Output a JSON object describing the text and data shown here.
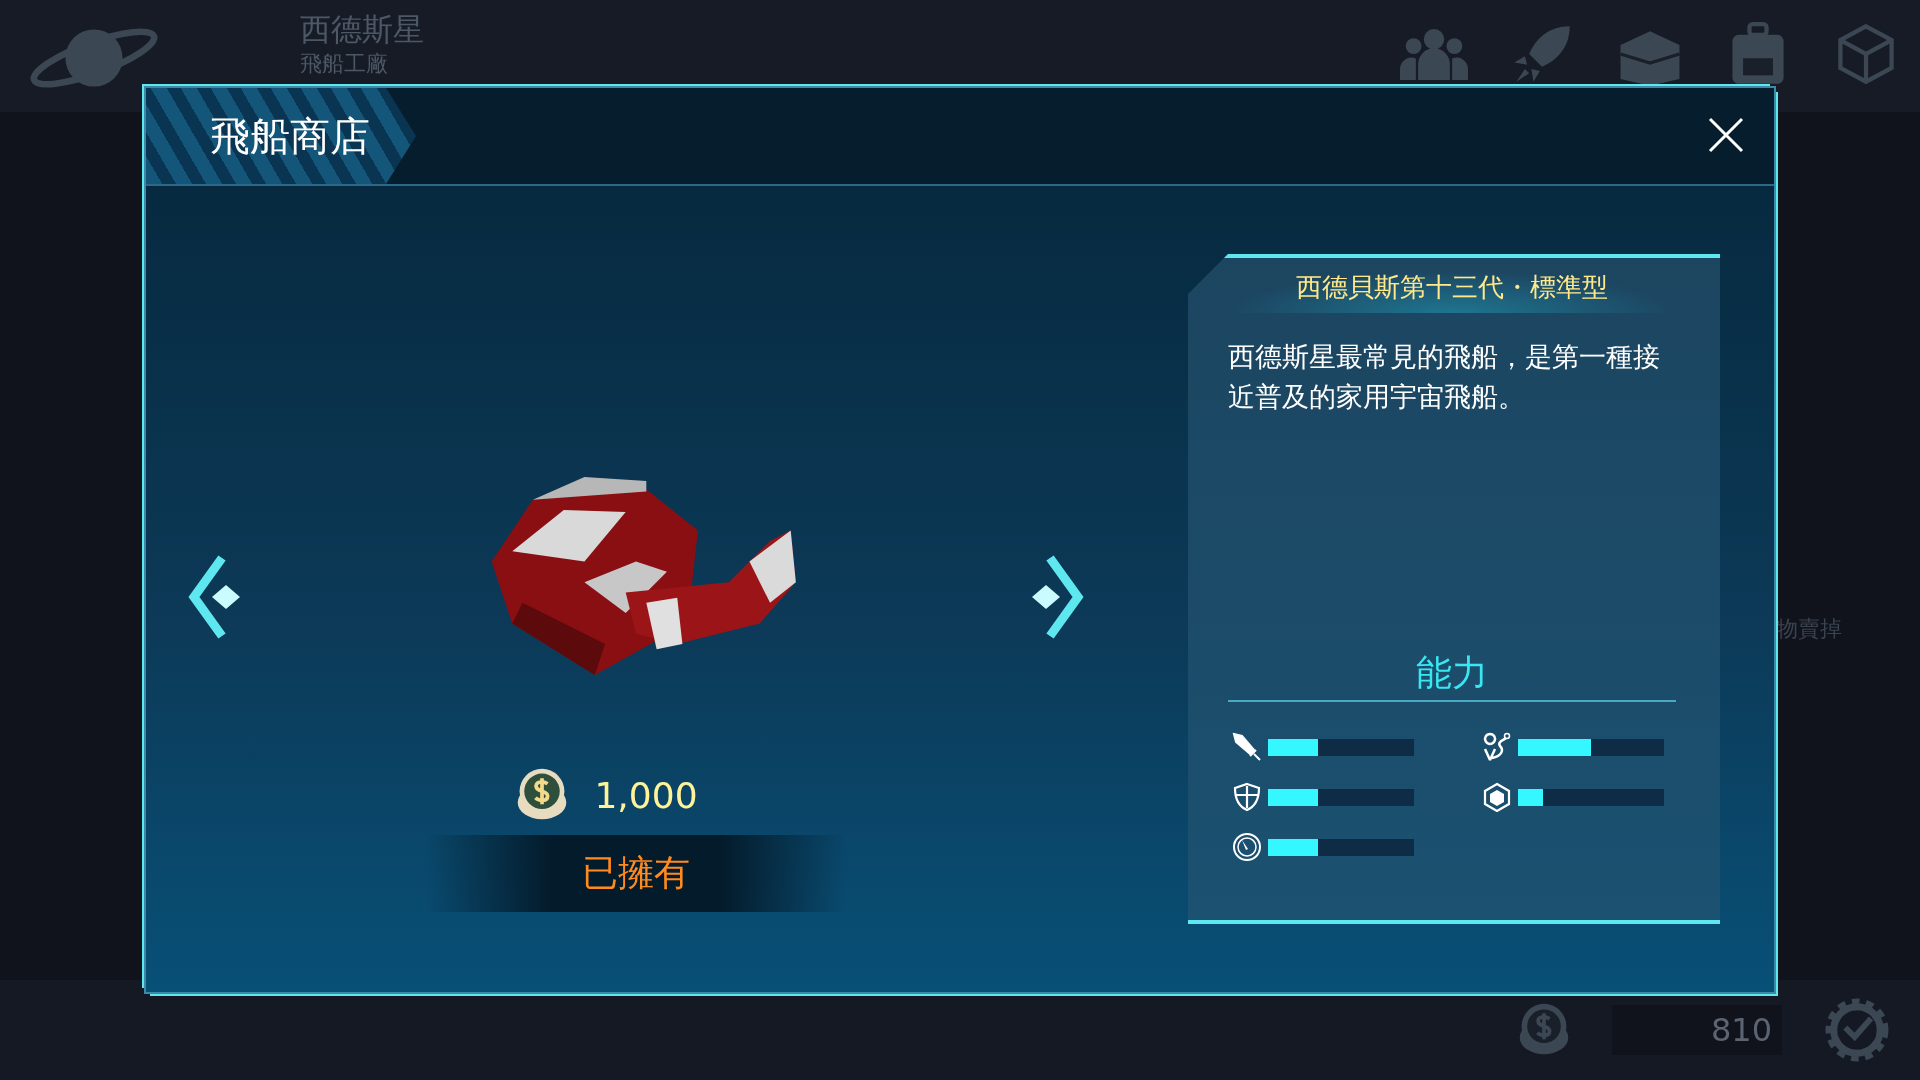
{
  "top_bar": {
    "location": "西德斯星",
    "sublocation": "飛船工廠"
  },
  "background_hint": "物賣掉",
  "modal": {
    "title": "飛船商店",
    "ship": {
      "price": "1,000",
      "status": "已擁有"
    },
    "info": {
      "name": "西德貝斯第十三代・標準型",
      "description": "西德斯星最常見的飛船，是第一種接近普及的家用宇宙飛船。",
      "stats_title": "能力",
      "stats": [
        {
          "level": 0.34
        },
        {
          "level": 0.5
        },
        {
          "level": 0.34
        },
        {
          "level": 0.17
        },
        {
          "level": 0.34
        }
      ]
    }
  },
  "bottom_bar": {
    "coins": "810"
  }
}
